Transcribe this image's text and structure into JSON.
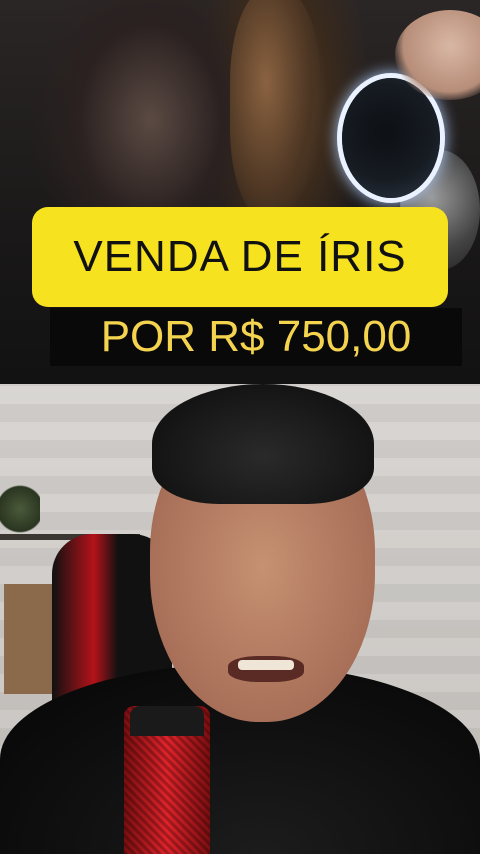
{
  "headline": {
    "title": "VENDA DE ÍRIS",
    "price": "POR R$ 750,00"
  },
  "colors": {
    "title_background": "#f7e21f",
    "title_text": "#111111",
    "price_background": "#080808",
    "price_text": "#f4d34e"
  },
  "icons": {
    "iris_scanner": "glowing-orb",
    "microphone": "red-microphone"
  }
}
